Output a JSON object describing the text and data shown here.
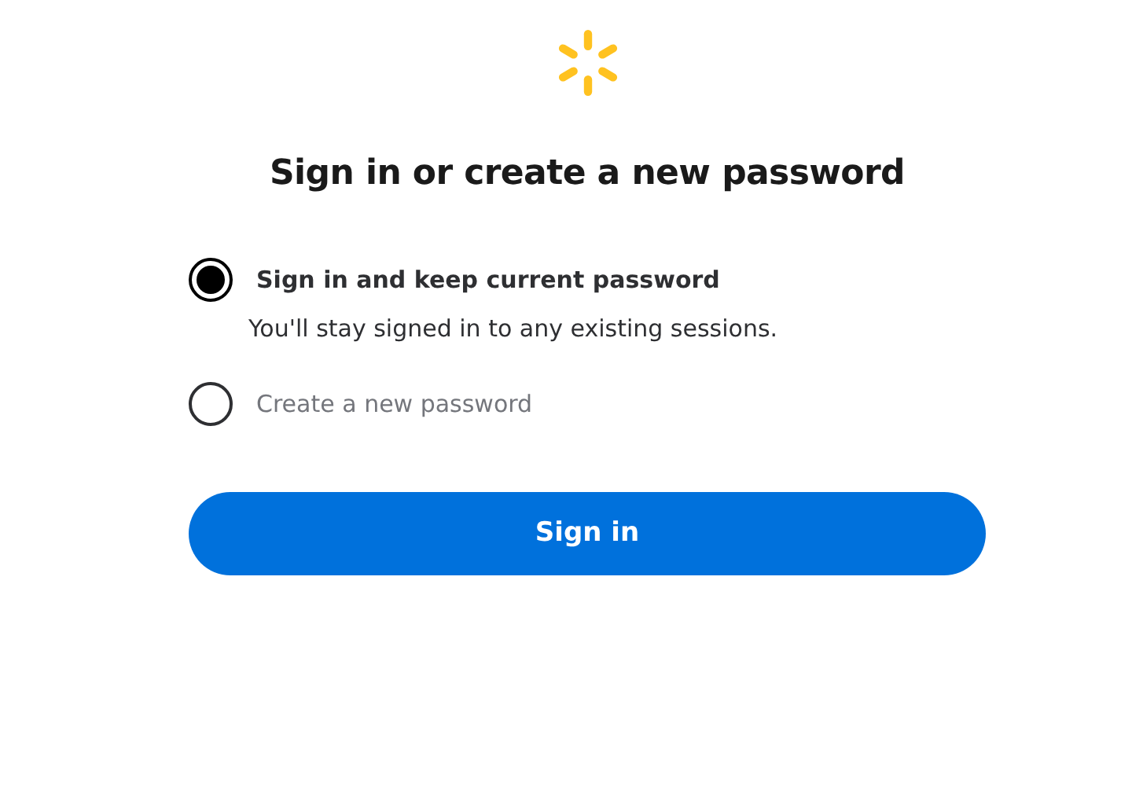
{
  "title": "Sign in or create a new password",
  "options": [
    {
      "label": "Sign in and keep current password",
      "description": "You'll stay signed in to any existing sessions.",
      "selected": true
    },
    {
      "label": "Create a new password",
      "selected": false
    }
  ],
  "button": "Sign in"
}
